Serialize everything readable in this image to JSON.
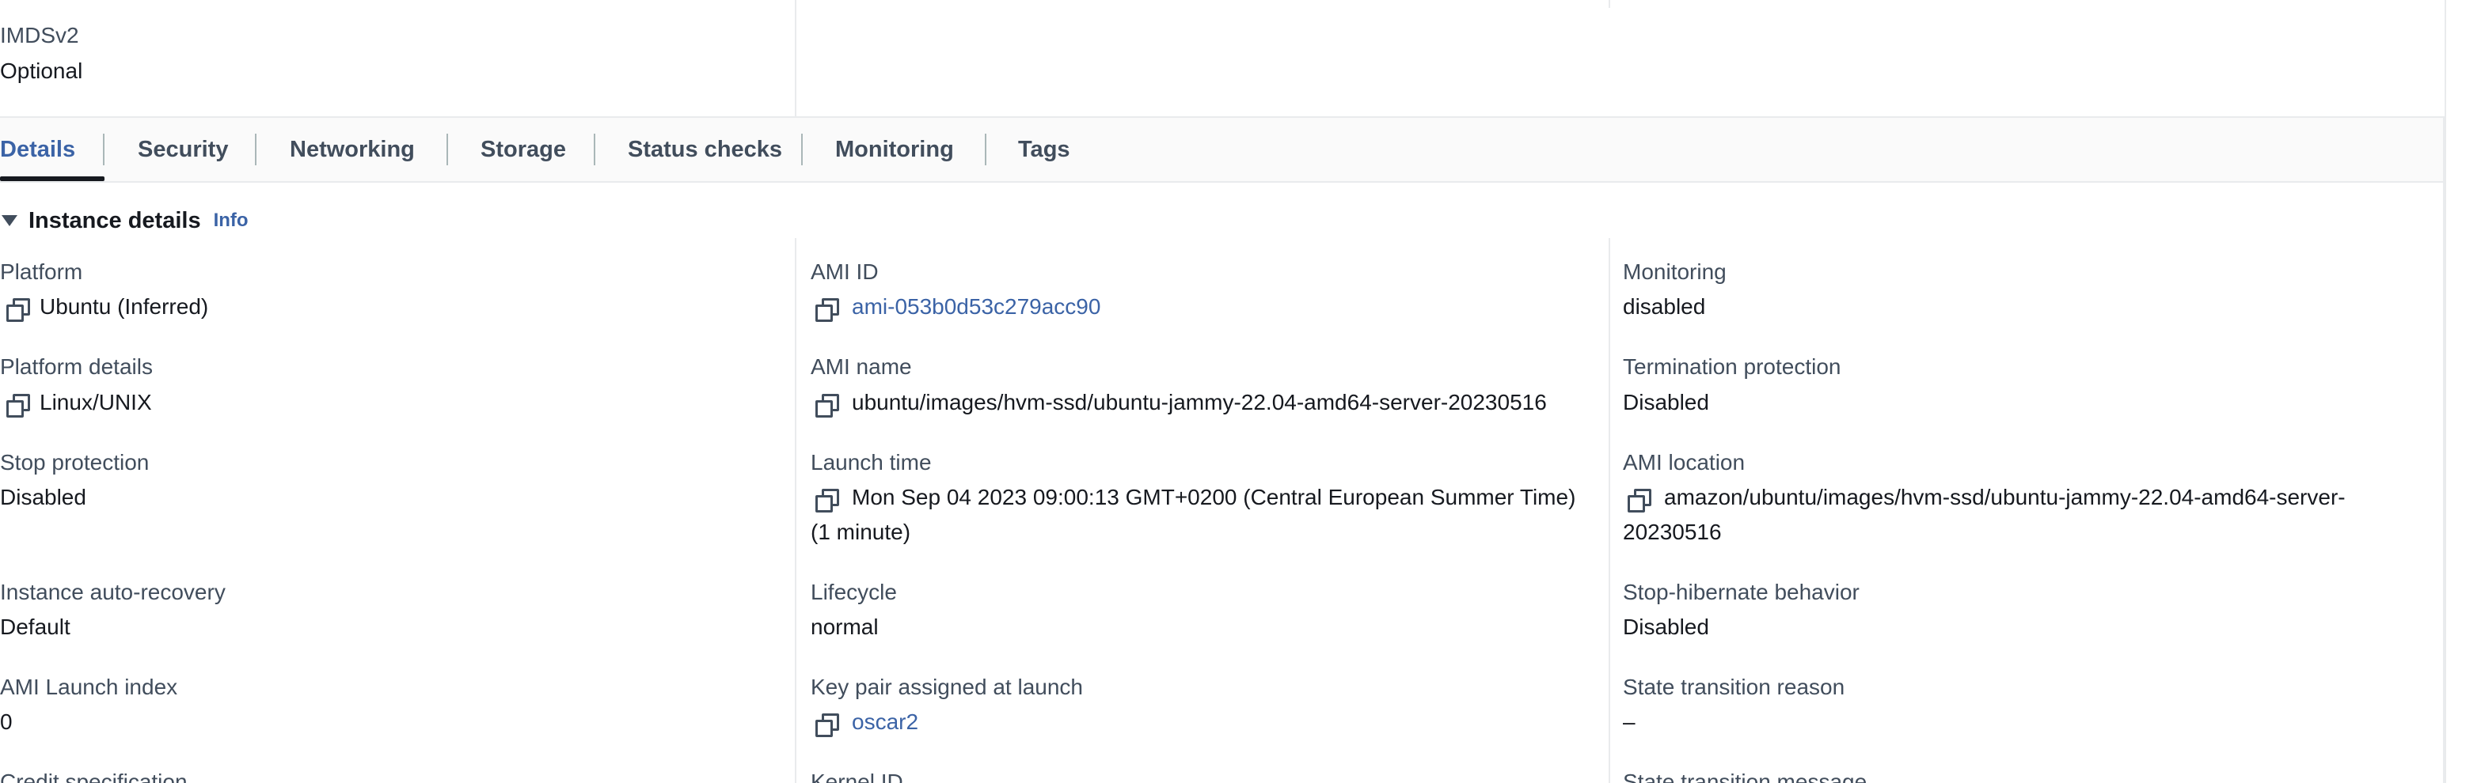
{
  "top": {
    "imds_label": "IMDSv2",
    "imds_value": "Optional"
  },
  "tabs": [
    {
      "label": "Details",
      "active": true
    },
    {
      "label": "Security"
    },
    {
      "label": "Networking"
    },
    {
      "label": "Storage"
    },
    {
      "label": "Status checks"
    },
    {
      "label": "Monitoring"
    },
    {
      "label": "Tags"
    }
  ],
  "section": {
    "title": "Instance details",
    "info": "Info"
  },
  "col1": {
    "platform_label": "Platform",
    "platform_value": "Ubuntu (Inferred)",
    "platform_details_label": "Platform details",
    "platform_details_value": "Linux/UNIX",
    "stop_protection_label": "Stop protection",
    "stop_protection_value": "Disabled",
    "auto_recovery_label": "Instance auto-recovery",
    "auto_recovery_value": "Default",
    "launch_index_label": "AMI Launch index",
    "launch_index_value": "0",
    "credit_label": "Credit specification"
  },
  "col2": {
    "ami_id_label": "AMI ID",
    "ami_id_value": "ami-053b0d53c279acc90",
    "ami_name_label": "AMI name",
    "ami_name_value": "ubuntu/images/hvm-ssd/ubuntu-jammy-22.04-amd64-server-20230516",
    "launch_time_label": "Launch time",
    "launch_time_value": "Mon Sep 04 2023 09:00:13 GMT+0200 (Central European Summer Time)",
    "launch_time_ago": "(1 minute)",
    "lifecycle_label": "Lifecycle",
    "lifecycle_value": "normal",
    "key_pair_label": "Key pair assigned at launch",
    "key_pair_value": "oscar2",
    "kernel_label": "Kernel ID"
  },
  "col3": {
    "monitoring_label": "Monitoring",
    "monitoring_value": "disabled",
    "termination_label": "Termination protection",
    "termination_value": "Disabled",
    "ami_location_label": "AMI location",
    "ami_location_value_1": "amazon/ubuntu/images/hvm-ssd/ubuntu-jammy-22.04-amd64-server-",
    "ami_location_value_2": "20230516",
    "hibernate_label": "Stop-hibernate behavior",
    "hibernate_value": "Disabled",
    "state_reason_label": "State transition reason",
    "state_reason_value": "–",
    "state_message_label": "State transition message"
  },
  "colors": {
    "link": "#3b63a6",
    "text": "#16191f",
    "label": "#414d5c",
    "divider": "#e9ebed"
  },
  "icons": [
    "copy-icon",
    "caret-down-icon"
  ]
}
